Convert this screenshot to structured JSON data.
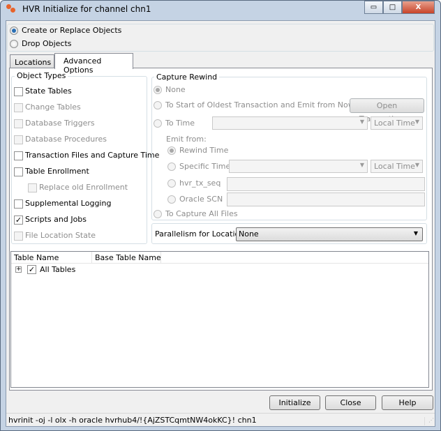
{
  "window": {
    "title": "HVR Initialize for channel chn1",
    "controls": {
      "minimize": "▭",
      "maximize": "□",
      "close": "X"
    }
  },
  "mode": {
    "options": [
      {
        "label": "Create or Replace Objects",
        "selected": true
      },
      {
        "label": "Drop Objects",
        "selected": false
      }
    ]
  },
  "tabs": [
    {
      "label": "Locations",
      "active": false
    },
    {
      "label": "Advanced Options",
      "active": true
    }
  ],
  "object_types": {
    "title": "Object Types",
    "items": [
      {
        "label": "State Tables",
        "checked": false,
        "enabled": true
      },
      {
        "label": "Change Tables",
        "checked": false,
        "enabled": false
      },
      {
        "label": "Database Triggers",
        "checked": false,
        "enabled": false
      },
      {
        "label": "Database Procedures",
        "checked": false,
        "enabled": false
      },
      {
        "label": "Transaction Files and Capture Time",
        "checked": false,
        "enabled": true
      },
      {
        "label": "Table Enrollment",
        "checked": false,
        "enabled": true
      },
      {
        "label": "Replace old Enrollment",
        "checked": false,
        "enabled": false
      },
      {
        "label": "Supplemental Logging",
        "checked": false,
        "enabled": true
      },
      {
        "label": "Scripts and Jobs",
        "checked": true,
        "enabled": true
      },
      {
        "label": "File Location State",
        "checked": false,
        "enabled": false
      }
    ]
  },
  "capture_rewind": {
    "title": "Capture Rewind",
    "none": "None",
    "oldest": "To Start of Oldest Transaction and Emit from Now",
    "open_transactions": "Open Transactions...",
    "to_time": "To Time",
    "to_time_value": "",
    "to_time_zone": "Local Time",
    "emit_from": "Emit from:",
    "rewind_time": "Rewind Time",
    "specific_time": "Specific Time",
    "specific_time_value": "",
    "specific_time_zone": "Local Time",
    "hvr_tx_seq": "hvr_tx_seq",
    "hvr_tx_seq_value": "",
    "oracle_scn": "Oracle SCN",
    "oracle_scn_value": "",
    "capture_all": "To Capture All Files"
  },
  "parallelism": {
    "label": "Parallelism for Locations",
    "value": "None"
  },
  "table": {
    "columns": [
      "Table Name",
      "Base Table Name"
    ],
    "rows": [
      {
        "label": "All Tables",
        "checked": true,
        "expand": "+"
      }
    ]
  },
  "buttons": {
    "initialize": "Initialize",
    "close": "Close",
    "help": "Help"
  },
  "status": {
    "command": "hvrinit -oj -l olx -h oracle hvrhub4/!{AjZSTCqmtNW4okKC}! chn1"
  }
}
